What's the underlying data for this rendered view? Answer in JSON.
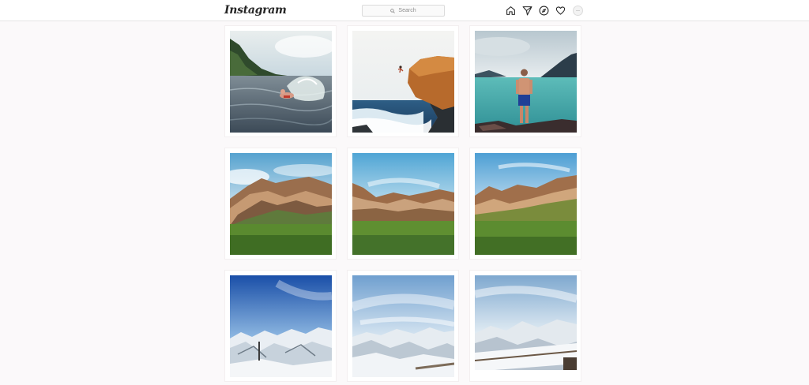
{
  "header": {
    "logo": "Instagram",
    "search_placeholder": "Search",
    "nav_icons": [
      "home-icon",
      "direct-send-icon",
      "explore-compass-icon",
      "activity-heart-icon",
      "profile-avatar"
    ]
  },
  "colors": {
    "page_background": "#fbf9fa",
    "header_background": "#ffffff",
    "border": "#dbdbdb",
    "icon": "#262626"
  },
  "feed": {
    "rows": [
      [
        "Swimmer in a lake below green mountains",
        "Person jumping off a rocky cliff into the sea",
        "Man standing on rocks facing a turquoise fjord"
      ],
      [
        "Striped mountains above a green meadow",
        "Colorful mountain ridge over grassland",
        "Sunlit mountain slopes and green field"
      ],
      [
        "Snowy mountain range under a deep blue sky",
        "Snow covered peaks under streaky clouds",
        "Snowy summit view with wooden railing"
      ]
    ]
  }
}
